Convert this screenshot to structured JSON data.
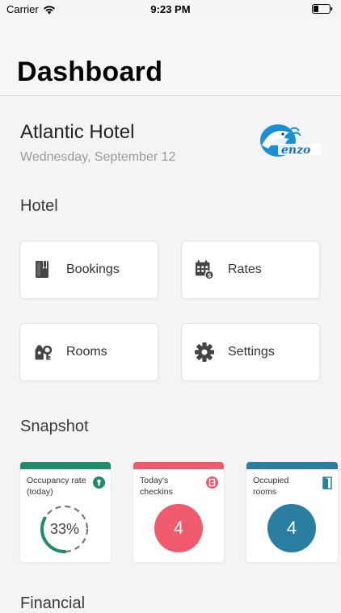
{
  "status_bar": {
    "carrier": "Carrier",
    "time": "9:23 PM"
  },
  "header": {
    "title": "Dashboard"
  },
  "hotel": {
    "name": "Atlantic Hotel",
    "date": "Wednesday, September 12",
    "logo_text": "enzo"
  },
  "sections": {
    "hotel": "Hotel",
    "snapshot": "Snapshot",
    "financial": "Financial"
  },
  "actions": [
    {
      "label": "Bookings",
      "icon": "bookings-icon"
    },
    {
      "label": "Rates",
      "icon": "rates-icon"
    },
    {
      "label": "Rooms",
      "icon": "rooms-icon"
    },
    {
      "label": "Settings",
      "icon": "settings-icon"
    }
  ],
  "snapshot": [
    {
      "label": "Occupancy rate (today)",
      "value": "33%",
      "percent": 33,
      "color": "#1f8a6c",
      "icon": "occupancy-icon"
    },
    {
      "label": "Today's checkins",
      "value": "4",
      "color": "#ef5a6c",
      "icon": "checkin-icon"
    },
    {
      "label": "Occupied rooms",
      "value": "4",
      "color": "#2a7ea0",
      "icon": "door-icon"
    }
  ],
  "colors": {
    "accent_green": "#1f8a6c",
    "accent_red": "#ef5a6c",
    "accent_blue": "#2a7ea0"
  }
}
